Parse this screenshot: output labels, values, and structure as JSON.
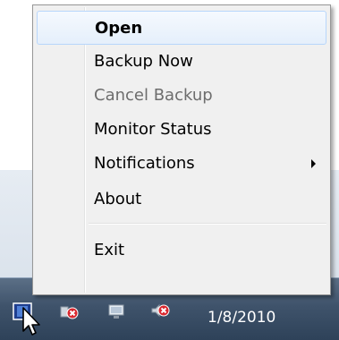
{
  "context_menu": {
    "items": [
      {
        "label": "Open",
        "state": "default-highlighted"
      },
      {
        "label": "Backup Now",
        "state": "enabled"
      },
      {
        "label": "Cancel Backup",
        "state": "disabled"
      },
      {
        "label": "Monitor Status",
        "state": "enabled"
      },
      {
        "label": "Notifications",
        "state": "submenu"
      },
      {
        "label": "About",
        "state": "enabled"
      },
      {
        "label": "Exit",
        "state": "enabled"
      }
    ]
  },
  "taskbar": {
    "clock": "1/8/2010",
    "tray_icons": [
      "backup-tray-icon",
      "network-error-icon",
      "display-icon",
      "volume-error-icon"
    ]
  },
  "colors": {
    "menu_background": "#f0f0f0",
    "highlight_border": "#b8d6fb",
    "disabled_text": "#6d6d6d",
    "taskbar": "#3f536b"
  }
}
